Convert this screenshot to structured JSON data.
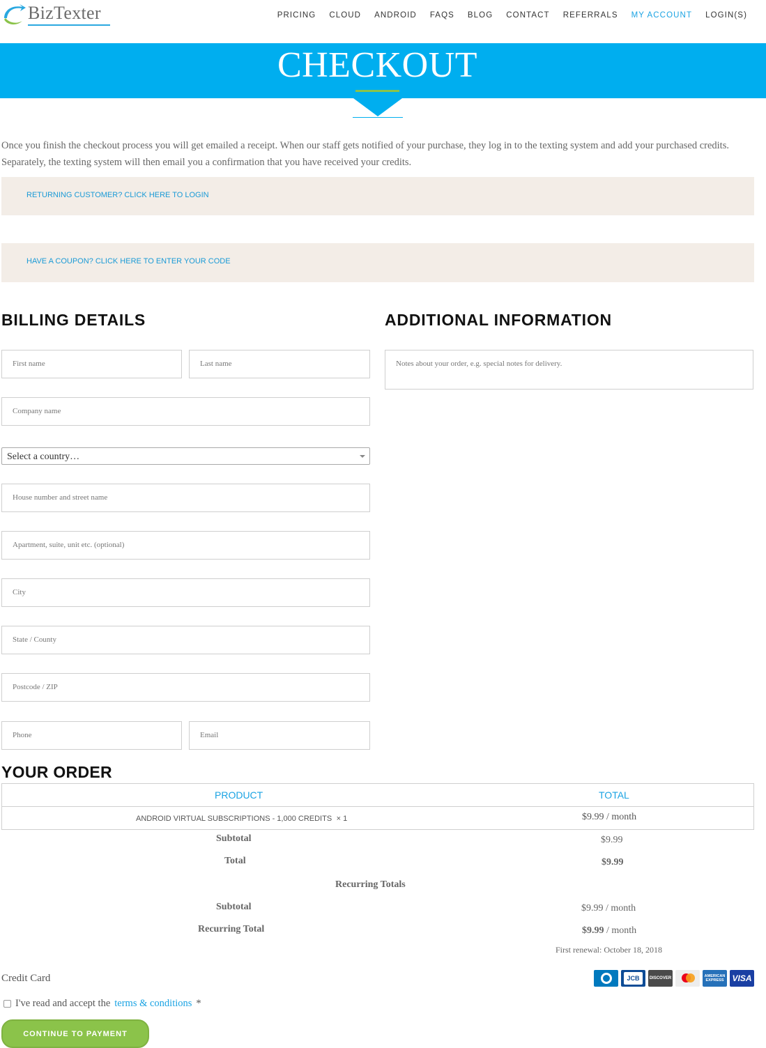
{
  "header": {
    "logo_text": "BizTexter",
    "nav": [
      "PRICING",
      "CLOUD",
      "ANDROID",
      "FAQS",
      "BLOG",
      "CONTACT",
      "REFERRALS",
      "MY ACCOUNT",
      "LOGIN(S)"
    ],
    "active_nav": "MY ACCOUNT"
  },
  "banner": {
    "title": "CHECKOUT"
  },
  "intro": "Once you finish the checkout process you will get emailed a receipt. When our staff gets notified of your purchase, they log in to the texting system and add your purchased credits. Separately, the texting system will then email you a confirmation that you have received your credits.",
  "notices": {
    "login": "RETURNING CUSTOMER? CLICK HERE TO LOGIN",
    "coupon": "HAVE A COUPON? CLICK HERE TO ENTER YOUR CODE"
  },
  "billing": {
    "heading": "BILLING DETAILS",
    "first_name": "First name",
    "last_name": "Last name",
    "company": "Company name",
    "country": "Select a country…",
    "street": "House number and street name",
    "apartment": "Apartment, suite, unit etc. (optional)",
    "city": "City",
    "state": "State / County",
    "postcode": "Postcode / ZIP",
    "phone": "Phone",
    "email": "Email"
  },
  "additional": {
    "heading": "ADDITIONAL INFORMATION",
    "notes": "Notes about your order, e.g. special notes for delivery."
  },
  "order": {
    "heading": "YOUR ORDER",
    "col_product": "PRODUCT",
    "col_total": "TOTAL",
    "product_name": "ANDROID VIRTUAL SUBSCRIPTIONS - 1,000 CREDITS",
    "product_qty": "× 1",
    "product_total": "$9.99 / month",
    "subtotal_label": "Subtotal",
    "subtotal_value": "$9.99",
    "total_label": "Total",
    "total_value": "$9.99",
    "recurring_heading": "Recurring Totals",
    "recurring_subtotal_label": "Subtotal",
    "recurring_subtotal_value": "$9.99 / month",
    "recurring_total_label": "Recurring Total",
    "recurring_total_amount": "$9.99",
    "recurring_total_period": "/ month",
    "first_renewal": "First renewal: October 18, 2018"
  },
  "payment": {
    "method": "Credit Card",
    "cards": [
      "diners-icon",
      "jcb-icon",
      "discover-icon",
      "mastercard-icon",
      "amex-icon",
      "visa-icon"
    ],
    "card_text": {
      "discover": "DISCOVER",
      "amex": "AMERICAN EXPRESS",
      "visa": "VISA",
      "jcb": "JCB"
    },
    "terms_prefix": "I've read and accept the",
    "terms_link": "terms & conditions",
    "terms_suffix": "*",
    "button": "CONTINUE TO PAYMENT"
  },
  "colors": {
    "brand_blue": "#00aeef",
    "link_blue": "#1aa3e3",
    "accent_green": "#8bc34a",
    "notice_bg": "#f3ede7"
  }
}
